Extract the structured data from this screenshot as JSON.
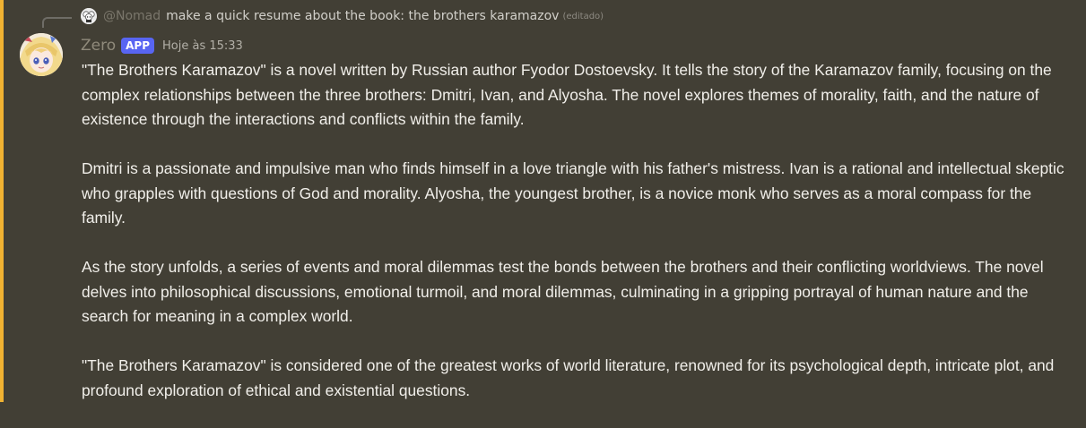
{
  "reply": {
    "mention": "@Nomad",
    "text": "make a quick resume about the book: the brothers karamazov",
    "edited": "(editado)"
  },
  "message": {
    "author": "Zero",
    "badge": "APP",
    "timestamp": "Hoje às 15:33",
    "paragraphs": [
      "\"The Brothers Karamazov\" is a novel written by Russian author Fyodor Dostoevsky. It tells the story of the Karamazov family, focusing on the complex relationships between the three brothers: Dmitri, Ivan, and Alyosha. The novel explores themes of morality, faith, and the nature of existence through the interactions and conflicts within the family.",
      "Dmitri is a passionate and impulsive man who finds himself in a love triangle with his father's mistress. Ivan is a rational and intellectual skeptic who grapples with questions of God and morality. Alyosha, the youngest brother, is a novice monk who serves as a moral compass for the family.",
      "As the story unfolds, a series of events and moral dilemmas test the bonds between the brothers and their conflicting worldviews. The novel delves into philosophical discussions, emotional turmoil, and moral dilemmas, culminating in a gripping portrayal of human nature and the search for meaning in a complex world.",
      "\"The Brothers Karamazov\" is considered one of the greatest works of world literature, renowned for its psychological depth, intricate plot, and profound exploration of ethical and existential questions."
    ]
  },
  "colors": {
    "background": "#423f35",
    "mention_bar": "#f0b232",
    "badge": "#5865f2",
    "text": "#f1efea"
  },
  "icons": {
    "reply_avatar": "user-avatar-icon",
    "author_avatar": "anime-avatar-icon"
  }
}
